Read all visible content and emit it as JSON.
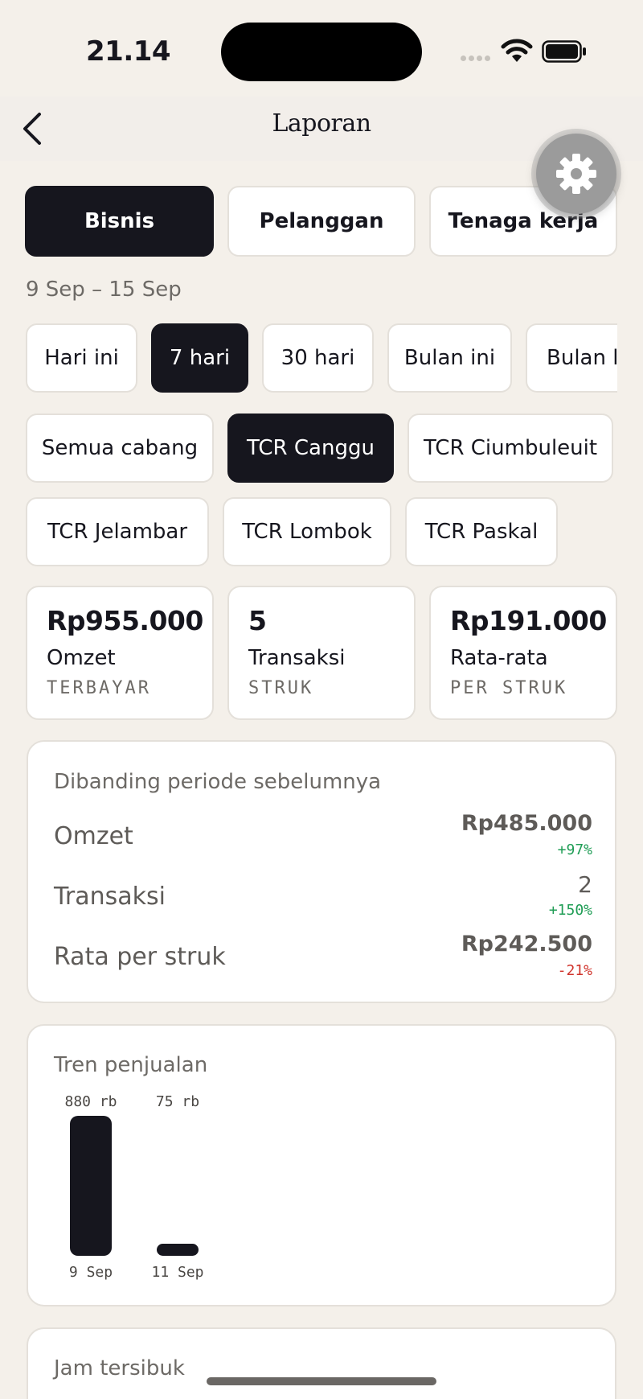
{
  "status_bar": {
    "time": "21.14"
  },
  "nav": {
    "title": "Laporan"
  },
  "tabs": [
    {
      "label": "Bisnis",
      "active": true
    },
    {
      "label": "Pelanggan",
      "active": false
    },
    {
      "label": "Tenaga kerja",
      "active": false
    }
  ],
  "date_range": "9 Sep – 15 Sep",
  "periods": [
    {
      "label": "Hari ini",
      "active": false
    },
    {
      "label": "7 hari",
      "active": true
    },
    {
      "label": "30 hari",
      "active": false
    },
    {
      "label": "Bulan ini",
      "active": false
    },
    {
      "label": "Bulan la",
      "active": false
    }
  ],
  "branches": [
    {
      "label": "Semua cabang",
      "active": false
    },
    {
      "label": "TCR Canggu",
      "active": true
    },
    {
      "label": "TCR Ciumbuleuit",
      "active": false
    },
    {
      "label": "TCR Jelambar",
      "active": false
    },
    {
      "label": "TCR Lombok",
      "active": false
    },
    {
      "label": "TCR Paskal",
      "active": false
    }
  ],
  "stats": [
    {
      "value": "Rp955.000",
      "label": "Omzet",
      "sub": "TERBAYAR"
    },
    {
      "value": "5",
      "label": "Transaksi",
      "sub": "STRUK"
    },
    {
      "value": "Rp191.000",
      "label": "Rata-rata",
      "sub": "PER STRUK"
    }
  ],
  "comparison": {
    "title": "Dibanding periode sebelumnya",
    "rows": [
      {
        "label": "Omzet",
        "value": "Rp485.000",
        "delta": "+97%",
        "trend": "up"
      },
      {
        "label": "Transaksi",
        "value": "2",
        "delta": "+150%",
        "trend": "up"
      },
      {
        "label": "Rata per struk",
        "value": "Rp242.500",
        "delta": "-21%",
        "trend": "down"
      }
    ]
  },
  "trend": {
    "title": "Tren penjualan",
    "chart_data": {
      "type": "bar",
      "categories": [
        "9 Sep",
        "11 Sep"
      ],
      "values": [
        880,
        75
      ],
      "value_labels": [
        "880 rb",
        "75 rb"
      ],
      "unit": "rb"
    }
  },
  "busiest": {
    "title": "Jam tersibuk"
  },
  "colors": {
    "accent": "#16161e",
    "background": "#f4f0ea",
    "up": "#1f9d55",
    "down": "#d0342c"
  }
}
